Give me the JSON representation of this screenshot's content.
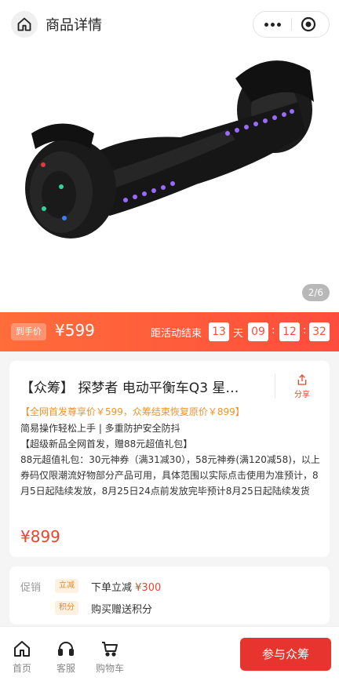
{
  "header": {
    "title": "商品详情"
  },
  "gallery": {
    "pager": "2/6"
  },
  "countdown": {
    "label": "到手价",
    "price": "¥599",
    "text": "距活动结束",
    "days": "13",
    "day_unit": "天",
    "hours": "09",
    "minutes": "12",
    "seconds": "32",
    "colon": ":"
  },
  "product": {
    "title": "【众筹】 探梦者 电动平衡车Q3 星…",
    "share_label": "分享",
    "promo": "【全网首发尊享价￥599，众筹结束恢复原价￥899】",
    "feature_line": "简易操作轻松上手 | 多重防护安全防抖",
    "gift_line": "【超级新品全网首发，赠88元超值礼包】",
    "description": "88元超值礼包：30元神券（满31减30），58元神券(满120减58)，以上券码仅限潮流好物部分产品可用，具体范围以实际点击使用为准预计，8月5日起陆续发放，8月25日24点前发放完毕预计8月25日起陆续发货",
    "price": "¥899"
  },
  "promotions": {
    "label": "促销",
    "items": [
      {
        "tag": "立减",
        "text": "下单立减",
        "amount": "¥300"
      },
      {
        "tag": "积分",
        "text": "购买赠送积分",
        "amount": ""
      }
    ]
  },
  "bottom_nav": {
    "home": "首页",
    "service": "客服",
    "cart": "购物车",
    "join": "参与众筹"
  },
  "colors": {
    "accent": "#e8452c",
    "countdown_start": "#ff6d3a",
    "countdown_end": "#ff4d3d"
  }
}
